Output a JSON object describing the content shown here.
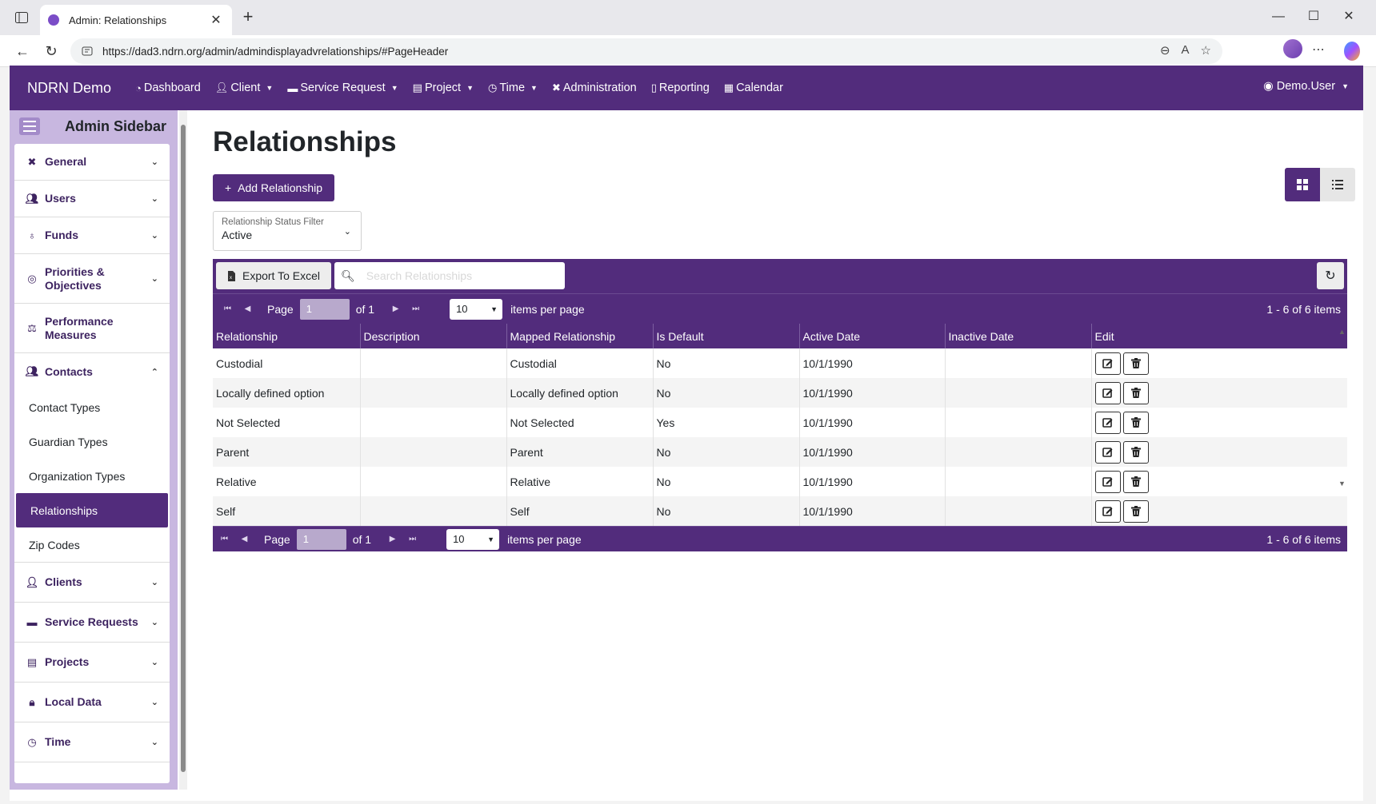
{
  "browser": {
    "tab_title": "Admin: Relationships",
    "url": "https://dad3.ndrn.org/admin/admindisplayadvrelationships/#PageHeader"
  },
  "topnav": {
    "brand": "NDRN Demo",
    "items": [
      {
        "label": "Dashboard",
        "icon": "gauge-icon",
        "dropdown": false
      },
      {
        "label": "Client",
        "icon": "user-icon",
        "dropdown": true
      },
      {
        "label": "Service Request",
        "icon": "briefcase-icon",
        "dropdown": true
      },
      {
        "label": "Project",
        "icon": "clipboard-icon",
        "dropdown": true
      },
      {
        "label": "Time",
        "icon": "clock-icon",
        "dropdown": true
      },
      {
        "label": "Administration",
        "icon": "tools-icon",
        "dropdown": false
      },
      {
        "label": "Reporting",
        "icon": "file-icon",
        "dropdown": false
      },
      {
        "label": "Calendar",
        "icon": "calendar-icon",
        "dropdown": false
      }
    ],
    "user": "Demo.User"
  },
  "sidebar": {
    "title": "Admin Sidebar",
    "sections": [
      {
        "label": "General",
        "icon": "tools-icon"
      },
      {
        "label": "Users",
        "icon": "users-icon"
      },
      {
        "label": "Funds",
        "icon": "money-bag-icon"
      },
      {
        "label": "Priorities & Objectives",
        "icon": "target-icon"
      },
      {
        "label": "Performance Measures",
        "icon": "scale-icon"
      },
      {
        "label": "Contacts",
        "icon": "users-icon",
        "expanded": true
      },
      {
        "label": "Clients",
        "icon": "user-icon"
      },
      {
        "label": "Service Requests",
        "icon": "briefcase-icon"
      },
      {
        "label": "Projects",
        "icon": "clipboard-icon"
      },
      {
        "label": "Local Data",
        "icon": "lock-icon"
      },
      {
        "label": "Time",
        "icon": "clock-icon"
      }
    ],
    "contacts_items": [
      "Contact Types",
      "Guardian Types",
      "Organization Types",
      "Relationships",
      "Zip Codes"
    ],
    "active_item": "Relationships"
  },
  "main": {
    "title": "Relationships",
    "add_button": "Add Relationship",
    "filter": {
      "label": "Relationship Status Filter",
      "value": "Active"
    },
    "export_button": "Export To Excel",
    "search_placeholder": "Search Relationships",
    "pager": {
      "page_label": "Page",
      "page_value": "1",
      "of_label": "of 1",
      "page_size": "10",
      "items_per_page": "items per page",
      "info": "1 - 6 of 6 items"
    },
    "columns": [
      "Relationship",
      "Description",
      "Mapped Relationship",
      "Is Default",
      "Active Date",
      "Inactive Date",
      "Edit"
    ],
    "rows": [
      [
        "Custodial",
        "",
        "Custodial",
        "No",
        "10/1/1990",
        ""
      ],
      [
        "Locally defined option",
        "",
        "Locally defined option",
        "No",
        "10/1/1990",
        ""
      ],
      [
        "Not Selected",
        "",
        "Not Selected",
        "Yes",
        "10/1/1990",
        ""
      ],
      [
        "Parent",
        "",
        "Parent",
        "No",
        "10/1/1990",
        ""
      ],
      [
        "Relative",
        "",
        "Relative",
        "No",
        "10/1/1990",
        ""
      ],
      [
        "Self",
        "",
        "Self",
        "No",
        "10/1/1990",
        ""
      ]
    ]
  },
  "colors": {
    "brand": "#522c7c",
    "sidebar_bg": "#c8b7e0"
  }
}
